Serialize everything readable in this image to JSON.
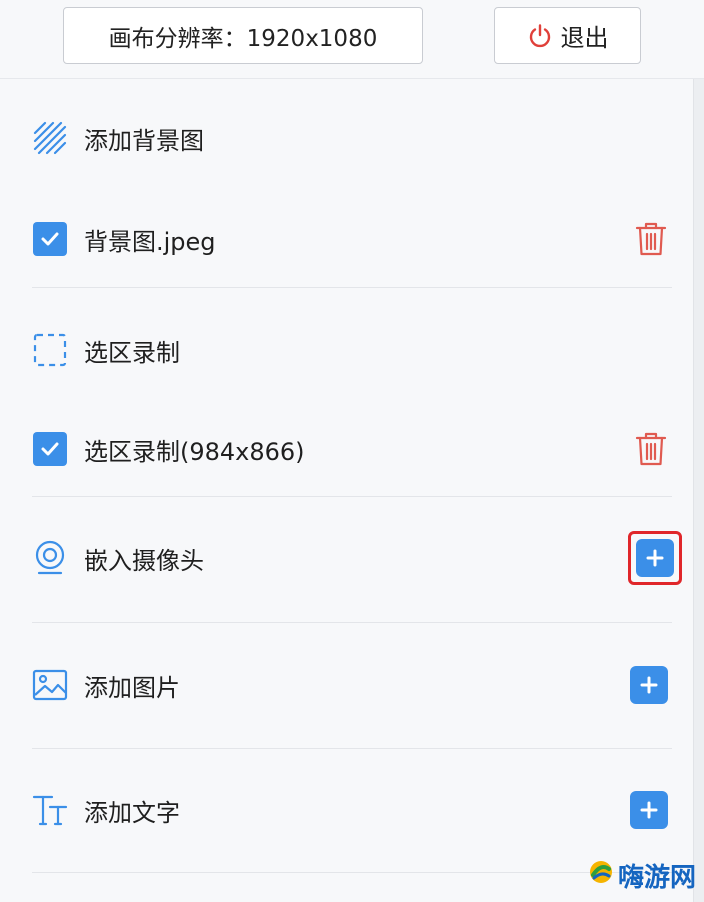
{
  "toolbar": {
    "resolution_label": "画布分辨率：1920x1080",
    "exit_label": "退出"
  },
  "items": [
    {
      "label": "添加背景图",
      "icon": "hatched-square-icon"
    },
    {
      "label": "背景图.jpeg",
      "icon": "checkbox-checked-icon",
      "action": "trash-icon"
    },
    {
      "label": "选区录制",
      "icon": "dashed-square-icon"
    },
    {
      "label": "选区录制(984x866)",
      "icon": "checkbox-checked-icon",
      "action": "trash-icon"
    },
    {
      "label": "嵌入摄像头",
      "icon": "camera-icon",
      "action": "plus-icon"
    },
    {
      "label": "添加图片",
      "icon": "image-icon",
      "action": "plus-icon"
    },
    {
      "label": "添加文字",
      "icon": "text-icon",
      "action": "plus-icon"
    }
  ],
  "watermark": {
    "text": "嗨游网"
  },
  "colors": {
    "accent": "#3b8fe8",
    "danger": "#e05a50",
    "highlight": "#e0262a",
    "background": "#f7f8fa"
  }
}
